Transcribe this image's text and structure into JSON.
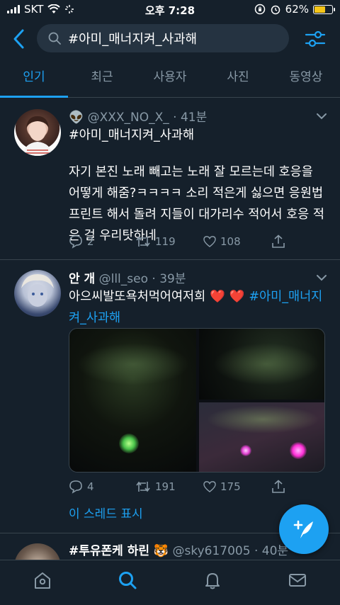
{
  "status_bar": {
    "carrier": "SKT",
    "time": "오후 7:28",
    "battery": "62%",
    "battery_level": 0.62
  },
  "search": {
    "query": "#아미_매너지켜_사과해"
  },
  "tabs": [
    {
      "label": "인기",
      "active": true
    },
    {
      "label": "최근",
      "active": false
    },
    {
      "label": "사용자",
      "active": false
    },
    {
      "label": "사진",
      "active": false
    },
    {
      "label": "동영상",
      "active": false
    }
  ],
  "tweets": [
    {
      "name": "👽",
      "handle": "@XXX_NO_X_",
      "time": "· 41분",
      "hashtag_line": "#아미_매너지켜_사과해",
      "text": "자기 본진 노래 빼고는 노래 잘 모르는데 호응을 어떻게 해줌?ㅋㅋㅋㅋ 소리 적은게 싫으면 응원법 프린트 해서 돌려 지들이 대가리수 적어서 호응 적은 걸 우리탓하네",
      "replies": "2",
      "retweets": "119",
      "likes": "108"
    },
    {
      "name": "안 개",
      "handle": "@lll_seo",
      "time": "· 39분",
      "text_plain": "아으씨발또욕처먹어여저희",
      "emoji": "❤️ ❤️",
      "hashtag": "#아미_매너지켜_사과해",
      "replies": "4",
      "retweets": "191",
      "likes": "175",
      "thread_link": "이 스레드 표시"
    },
    {
      "name": "#투유폰케 하린 🐯",
      "handle": "@sky617005",
      "time": "· 40분"
    }
  ],
  "colors": {
    "background": "#15202b",
    "accent": "#1da1f2",
    "secondary_text": "#8899a6",
    "divider": "#38444d"
  },
  "icons": {
    "back": "back-arrow-icon",
    "filter": "filter-sliders-icon",
    "compose": "compose-tweet-icon",
    "nav": [
      "home-icon",
      "search-icon",
      "notifications-bell-icon",
      "messages-mail-icon"
    ]
  }
}
